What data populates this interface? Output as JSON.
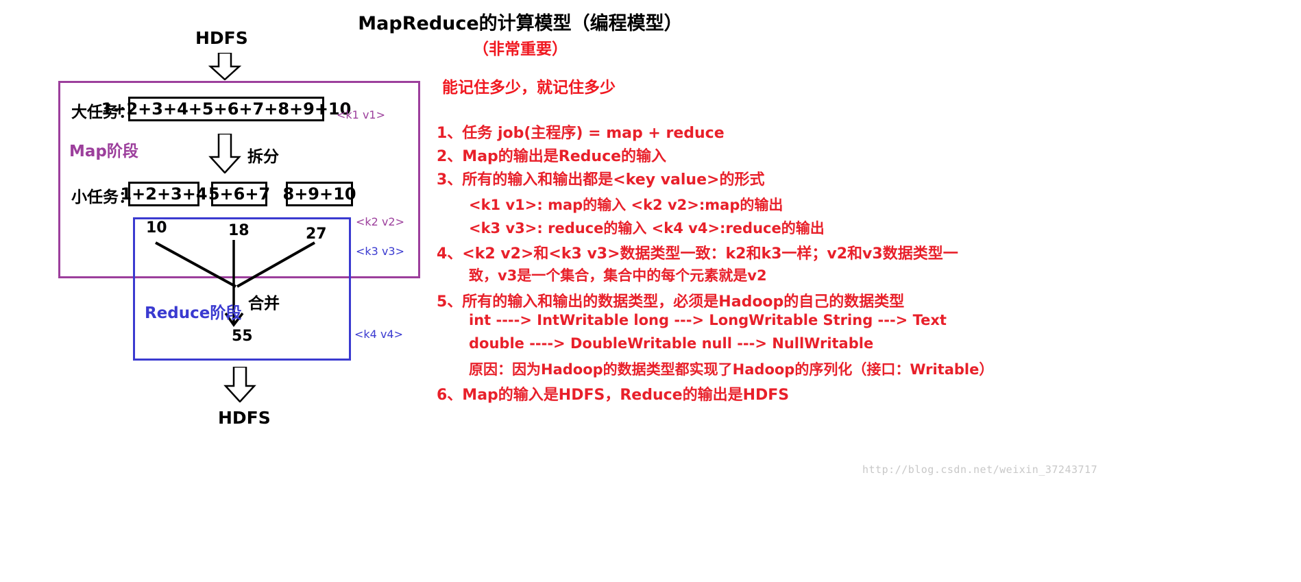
{
  "title": {
    "main": "MapReduce的计算模型（编程模型）",
    "sub": "（非常重要）"
  },
  "diagram": {
    "hdfs_top": "HDFS",
    "hdfs_bottom": "HDFS",
    "map_stage_label": "Map阶段",
    "reduce_stage_label": "Reduce阶段",
    "big_task_label": "大任务：",
    "big_task_value": "1+2+3+4+5+6+7+8+9+10",
    "small_task_label": "小任务：",
    "small_tasks": [
      "1+2+3+4",
      "5+6+7",
      "8+9+10"
    ],
    "split_label": "拆分",
    "merge_label": "合并",
    "partial_results": [
      "10",
      "18",
      "27"
    ],
    "final_result": "55",
    "kv_labels": [
      {
        "text": "<k1  v1>",
        "color": "#9c3f9c"
      },
      {
        "text": "<k2  v2>",
        "color": "#9c3f9c"
      },
      {
        "text": "<k3  v3>",
        "color": "#3a3ad0"
      },
      {
        "text": "<k4  v4>",
        "color": "#3a3ad0"
      }
    ]
  },
  "notes": {
    "headline": "能记住多少，就记住多少",
    "items": [
      "1、任务 job(主程序) = map + reduce",
      "2、Map的输出是Reduce的输入",
      "3、所有的输入和输出都是<key value>的形式",
      "<k1 v1>: map的输入     <k2  v2>:map的输出",
      "<k3 v3>: reduce的输入   <k4 v4>:reduce的输出",
      "4、<k2 v2>和<k3 v3>数据类型一致：k2和k3一样；v2和v3数据类型一",
      "致，v3是一个集合，集合中的每个元素就是v2",
      "5、所有的输入和输出的数据类型，必须是Hadoop的自己的数据类型",
      "int ----> IntWritable   long ---> LongWritable   String ---> Text",
      "double  ----> DoubleWritable   null   ---> NullWritable",
      "原因：因为Hadoop的数据类型都实现了Hadoop的序列化（接口：Writable）",
      "6、Map的输入是HDFS，Reduce的输出是HDFS"
    ]
  },
  "watermark": "http://blog.csdn.net/weixin_37243717",
  "colors": {
    "map_purple": "#9c3f9c",
    "reduce_blue": "#3a3ad0",
    "note_red": "#e8202a",
    "title_red": "#f01820"
  }
}
